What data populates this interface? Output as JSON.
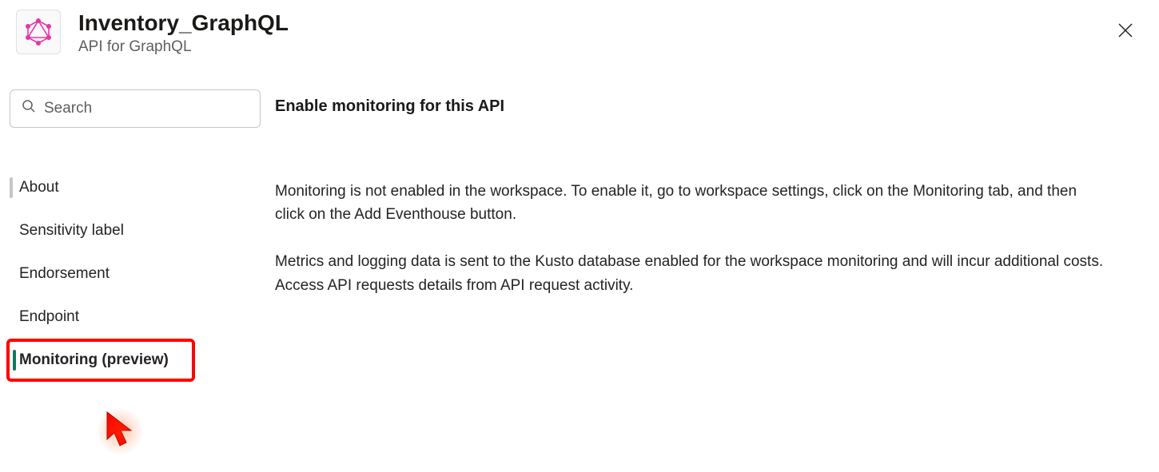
{
  "header": {
    "title": "Inventory_GraphQL",
    "subtitle": "API for GraphQL"
  },
  "search": {
    "placeholder": "Search"
  },
  "sidebar": {
    "items": [
      {
        "label": "About"
      },
      {
        "label": "Sensitivity label"
      },
      {
        "label": "Endorsement"
      },
      {
        "label": "Endpoint"
      },
      {
        "label": "Monitoring (preview)"
      }
    ]
  },
  "content": {
    "heading": "Enable monitoring for this API",
    "para1": "Monitoring is not enabled in the workspace. To enable it, go to workspace settings, click on the Monitoring tab, and then click on the Add Eventhouse button.",
    "para2": "Metrics and logging data is sent to the Kusto database enabled for the workspace monitoring and will incur additional costs. Access API requests details from API request activity."
  }
}
